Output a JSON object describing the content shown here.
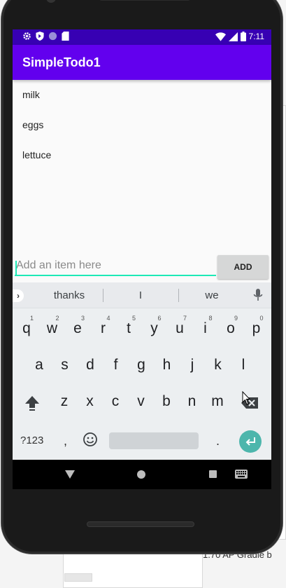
{
  "status_bar": {
    "time": "7:11",
    "left_icons": [
      "gear-icon",
      "shield-icon",
      "circle-icon",
      "sd-card-icon"
    ],
    "right_icons": [
      "wifi-icon",
      "signal-icon",
      "battery-icon"
    ]
  },
  "app": {
    "title": "SimpleTodo1",
    "accent": "#6200ee",
    "status_color": "#3700b3"
  },
  "todo_items": [
    "milk",
    "eggs",
    "lettuce"
  ],
  "input": {
    "placeholder": "Add an item here",
    "value": ""
  },
  "add_button": {
    "label": "ADD"
  },
  "keyboard": {
    "suggestions": [
      "thanks",
      "I",
      "we"
    ],
    "row1": [
      {
        "k": "q",
        "n": "1"
      },
      {
        "k": "w",
        "n": "2"
      },
      {
        "k": "e",
        "n": "3"
      },
      {
        "k": "r",
        "n": "4"
      },
      {
        "k": "t",
        "n": "5"
      },
      {
        "k": "y",
        "n": "6"
      },
      {
        "k": "u",
        "n": "7"
      },
      {
        "k": "i",
        "n": "8"
      },
      {
        "k": "o",
        "n": "9"
      },
      {
        "k": "p",
        "n": "0"
      }
    ],
    "row2": [
      "a",
      "s",
      "d",
      "f",
      "g",
      "h",
      "j",
      "k",
      "l"
    ],
    "row3": [
      "z",
      "x",
      "c",
      "v",
      "b",
      "n",
      "m"
    ],
    "symbols_label": "?123",
    "comma": ",",
    "period": "."
  },
  "background": {
    "partial_text": "1.70 AP Gradle b"
  }
}
